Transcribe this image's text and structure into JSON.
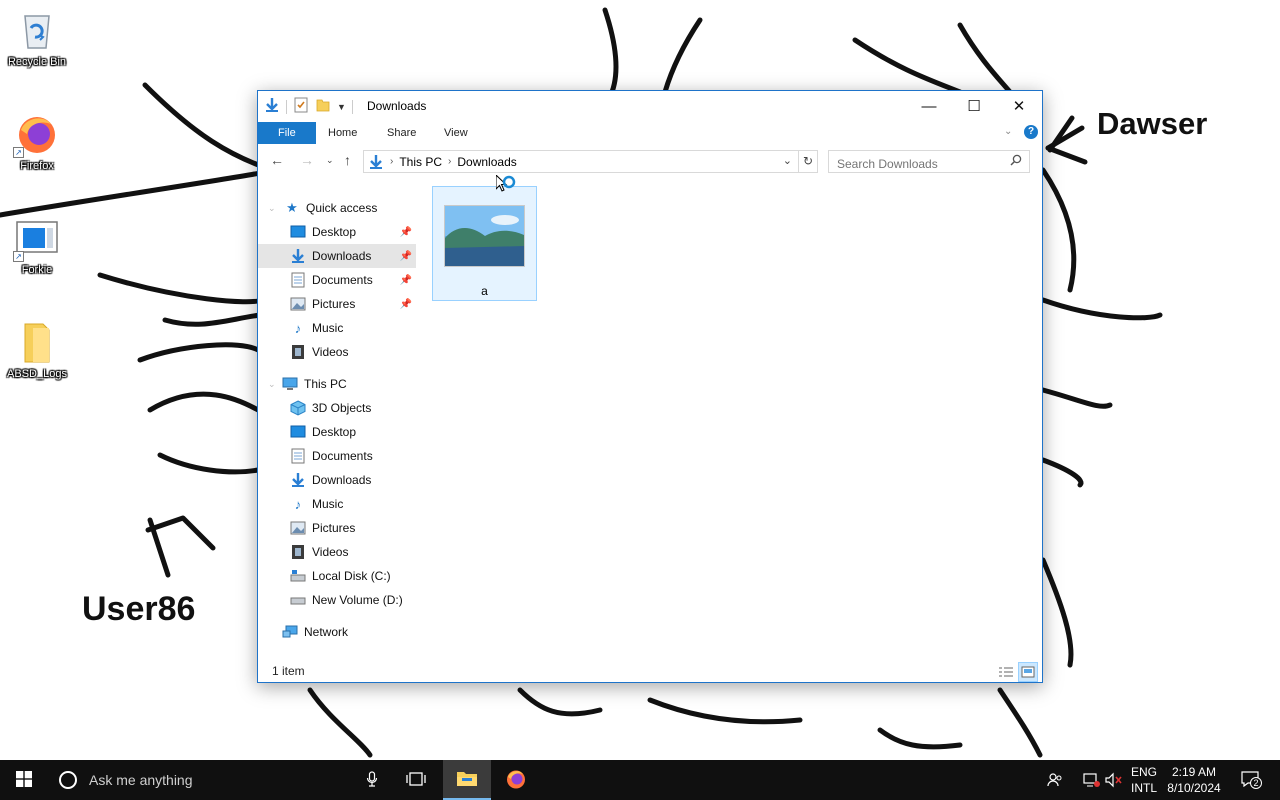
{
  "desktop": {
    "icons": [
      {
        "label": "Recycle Bin",
        "icon": "recycle-bin-icon"
      },
      {
        "label": "Firefox",
        "icon": "firefox-icon"
      },
      {
        "label": "Forkie",
        "icon": "app-window-icon"
      },
      {
        "label": "ABSD_Logs",
        "icon": "folder-icon"
      }
    ],
    "annotations": {
      "top_right": "Dawser",
      "bottom_left": "User86"
    }
  },
  "explorer": {
    "title": "Downloads",
    "window_buttons": {
      "minimize": "—",
      "maximize": "☐",
      "close": "✕"
    },
    "ribbon_tabs": [
      "File",
      "Home",
      "Share",
      "View"
    ],
    "address": {
      "root": "This PC",
      "current": "Downloads"
    },
    "search_placeholder": "Search Downloads",
    "nav": {
      "quick_access": "Quick access",
      "quick_items": [
        "Desktop",
        "Downloads",
        "Documents",
        "Pictures",
        "Music",
        "Videos"
      ],
      "this_pc": "This PC",
      "pc_items": [
        "3D Objects",
        "Desktop",
        "Documents",
        "Downloads",
        "Music",
        "Pictures",
        "Videos",
        "Local Disk (C:)",
        "New Volume (D:)"
      ],
      "network": "Network"
    },
    "files": [
      {
        "name": "a",
        "type": "image"
      }
    ],
    "status": "1 item"
  },
  "taskbar": {
    "search_placeholder": "Ask me anything",
    "lang_line1": "ENG",
    "lang_line2": "INTL",
    "time": "2:19 AM",
    "date": "8/10/2024",
    "notifications": "2"
  }
}
